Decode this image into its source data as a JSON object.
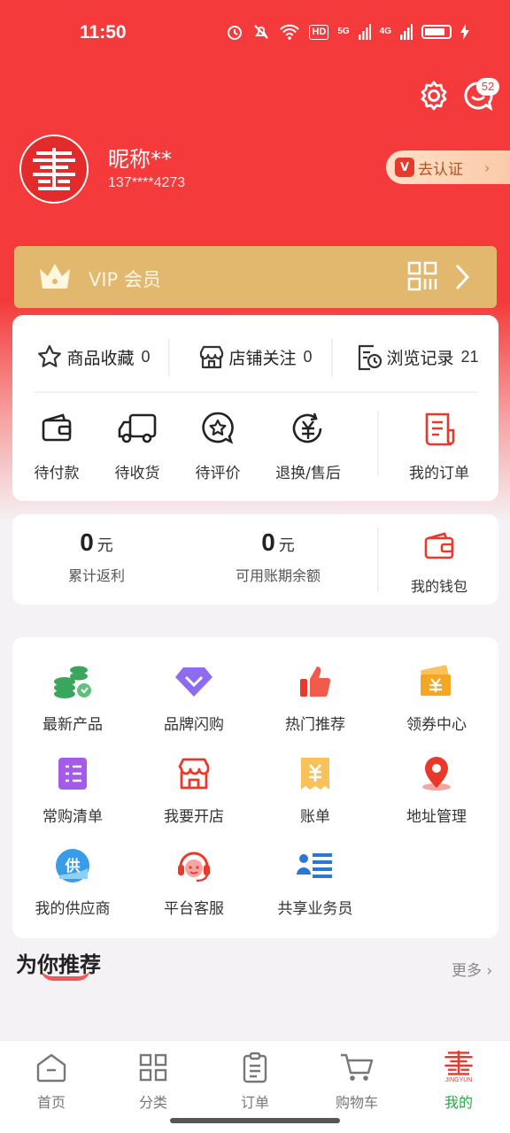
{
  "status_bar": {
    "time": "11:50",
    "network_5g": "5G",
    "network_4g": "4G",
    "hd_label": "HD"
  },
  "header": {
    "message_badge": "52"
  },
  "profile": {
    "nickname": "昵称**",
    "phone": "137****4273",
    "verify_label": "去认证",
    "verify_badge": "V",
    "avatar_color": "#e32b2b"
  },
  "vip": {
    "label": "VIP 会员",
    "bar_color": "#e2b86f"
  },
  "stats": [
    {
      "label": "商品收藏",
      "count": "0",
      "icon": "star-icon"
    },
    {
      "label": "店铺关注",
      "count": "0",
      "icon": "shop-icon"
    },
    {
      "label": "浏览记录",
      "count": "21",
      "icon": "history-icon"
    }
  ],
  "orders": [
    {
      "label": "待付款",
      "icon": "wallet-icon"
    },
    {
      "label": "待收货",
      "icon": "truck-icon"
    },
    {
      "label": "待评价",
      "icon": "review-icon"
    },
    {
      "label": "退换/售后",
      "icon": "refund-icon"
    },
    {
      "label": "我的订单",
      "icon": "order-list-icon"
    }
  ],
  "wallet": {
    "rebate_value": "0",
    "rebate_unit": "元",
    "rebate_label": "累计返利",
    "credit_value": "0",
    "credit_unit": "元",
    "credit_label": "可用账期余额",
    "wallet_label": "我的钱包"
  },
  "services": [
    {
      "label": "最新产品",
      "icon": "coins-icon"
    },
    {
      "label": "品牌闪购",
      "icon": "diamond-icon"
    },
    {
      "label": "热门推荐",
      "icon": "thumbs-up-icon"
    },
    {
      "label": "领券中心",
      "icon": "coupon-icon"
    },
    {
      "label": "常购清单",
      "icon": "list-icon"
    },
    {
      "label": "我要开店",
      "icon": "store-icon"
    },
    {
      "label": "账单",
      "icon": "bill-icon"
    },
    {
      "label": "地址管理",
      "icon": "location-icon"
    },
    {
      "label": "我的供应商",
      "icon": "supplier-icon"
    },
    {
      "label": "平台客服",
      "icon": "headset-icon"
    },
    {
      "label": "共享业务员",
      "icon": "staff-icon"
    }
  ],
  "recommend": {
    "title": "为你推荐",
    "more": "更多"
  },
  "tabbar": [
    {
      "label": "首页",
      "icon": "home-icon"
    },
    {
      "label": "分类",
      "icon": "category-icon"
    },
    {
      "label": "订单",
      "icon": "order-icon"
    },
    {
      "label": "购物车",
      "icon": "cart-icon"
    },
    {
      "label": "我的",
      "icon": "logo-icon",
      "sub": "JINGYUN"
    }
  ],
  "colors": {
    "primary_red": "#f43a3a",
    "active_tab": "#2aa84a",
    "vip_gold": "#e2b86f"
  }
}
